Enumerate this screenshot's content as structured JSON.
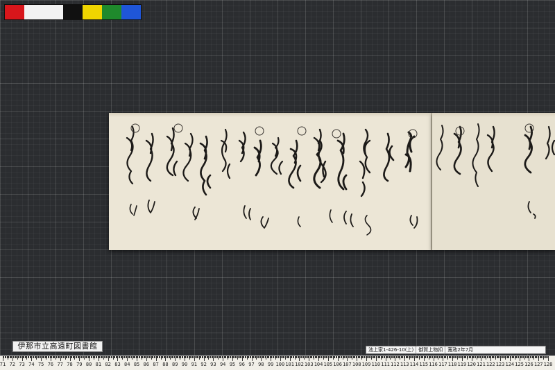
{
  "color_chart": {
    "swatches": [
      "#d8161b",
      "#f2f2f2",
      "#101010",
      "#efd500",
      "#1f8a2c",
      "#1f56d8"
    ]
  },
  "library_label": "伊那市立高遠町図書館",
  "catalog": {
    "id": "池上家1-426-10(上)",
    "title": "御賀上物扣",
    "date": "寛政2年7月"
  },
  "ruler": {
    "start": 71,
    "end": 128
  }
}
